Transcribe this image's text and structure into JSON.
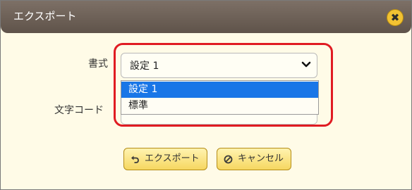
{
  "dialog": {
    "title": "エクスポート",
    "close_icon": "close-icon"
  },
  "form": {
    "format_label": "書式",
    "format_value": "設定 1",
    "format_options": [
      "設定 1",
      "標準"
    ],
    "encoding_label": "文字コード"
  },
  "buttons": {
    "export_label": "エクスポート",
    "export_icon": "undo-arrow-icon",
    "cancel_label": "キャンセル",
    "cancel_icon": "cancel-circle-icon"
  },
  "colors": {
    "accent": "#f2c232",
    "selection": "#1976e7",
    "highlight": "#e01b22"
  }
}
